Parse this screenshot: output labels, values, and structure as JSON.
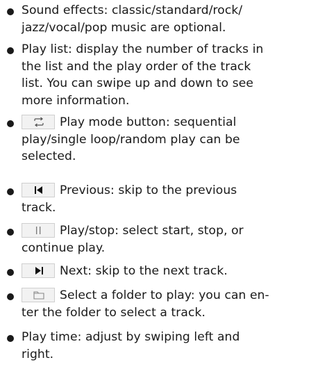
{
  "items": [
    {
      "lines": [
        "Sound effects: classic/standard/rock/",
        "jazz/vocal/pop music are optional."
      ]
    },
    {
      "lines": [
        "Play list: display the number of tracks in",
        "the list and the play order of the track",
        "list. You can swipe up and down to see",
        "more information."
      ]
    },
    {
      "icon": "repeat-icon",
      "lines": [
        "Play mode button: sequential",
        "play/single loop/random play can be",
        "selected."
      ]
    },
    {
      "icon": "previous-track-icon",
      "lines": [
        "Previous: skip to the previous",
        "track."
      ]
    },
    {
      "icon": "pause-icon",
      "lines": [
        "Play/stop: select start, stop, or",
        "continue play."
      ]
    },
    {
      "icon": "next-track-icon",
      "lines": [
        "Next: skip to the next track."
      ]
    },
    {
      "icon": "folder-icon",
      "lines": [
        "Select a folder to play: you can en-",
        "ter the folder to select a track."
      ]
    },
    {
      "lines": [
        "Play time: adjust by swiping left and",
        "right."
      ]
    }
  ]
}
